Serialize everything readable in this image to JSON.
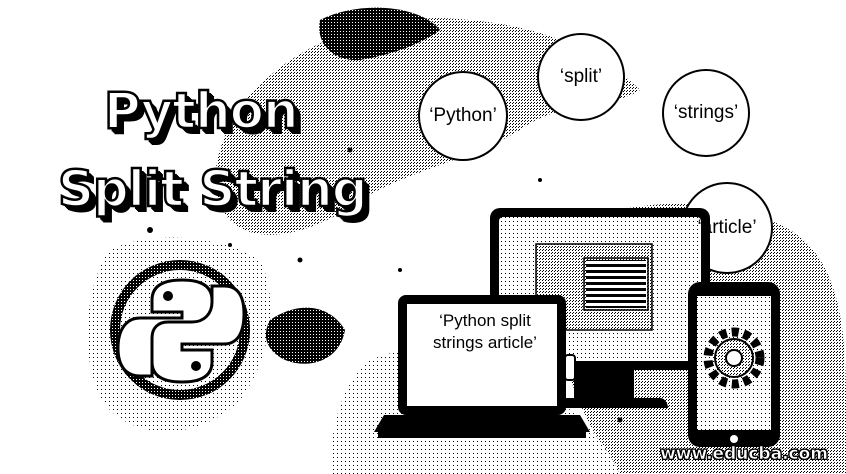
{
  "title": {
    "line1": "Python",
    "line2": "Split String"
  },
  "bubbles": [
    {
      "text": "‘Python’"
    },
    {
      "text": "‘split’"
    },
    {
      "text": "‘strings’"
    },
    {
      "text": "‘article’"
    }
  ],
  "laptop": {
    "text": "‘Python split strings article’"
  },
  "footer": {
    "website": "www.educba.com"
  },
  "icons": [
    "python-logo-icon",
    "gear-icon",
    "monitor-icon",
    "laptop-icon",
    "tablet-icon",
    "document-icon"
  ]
}
